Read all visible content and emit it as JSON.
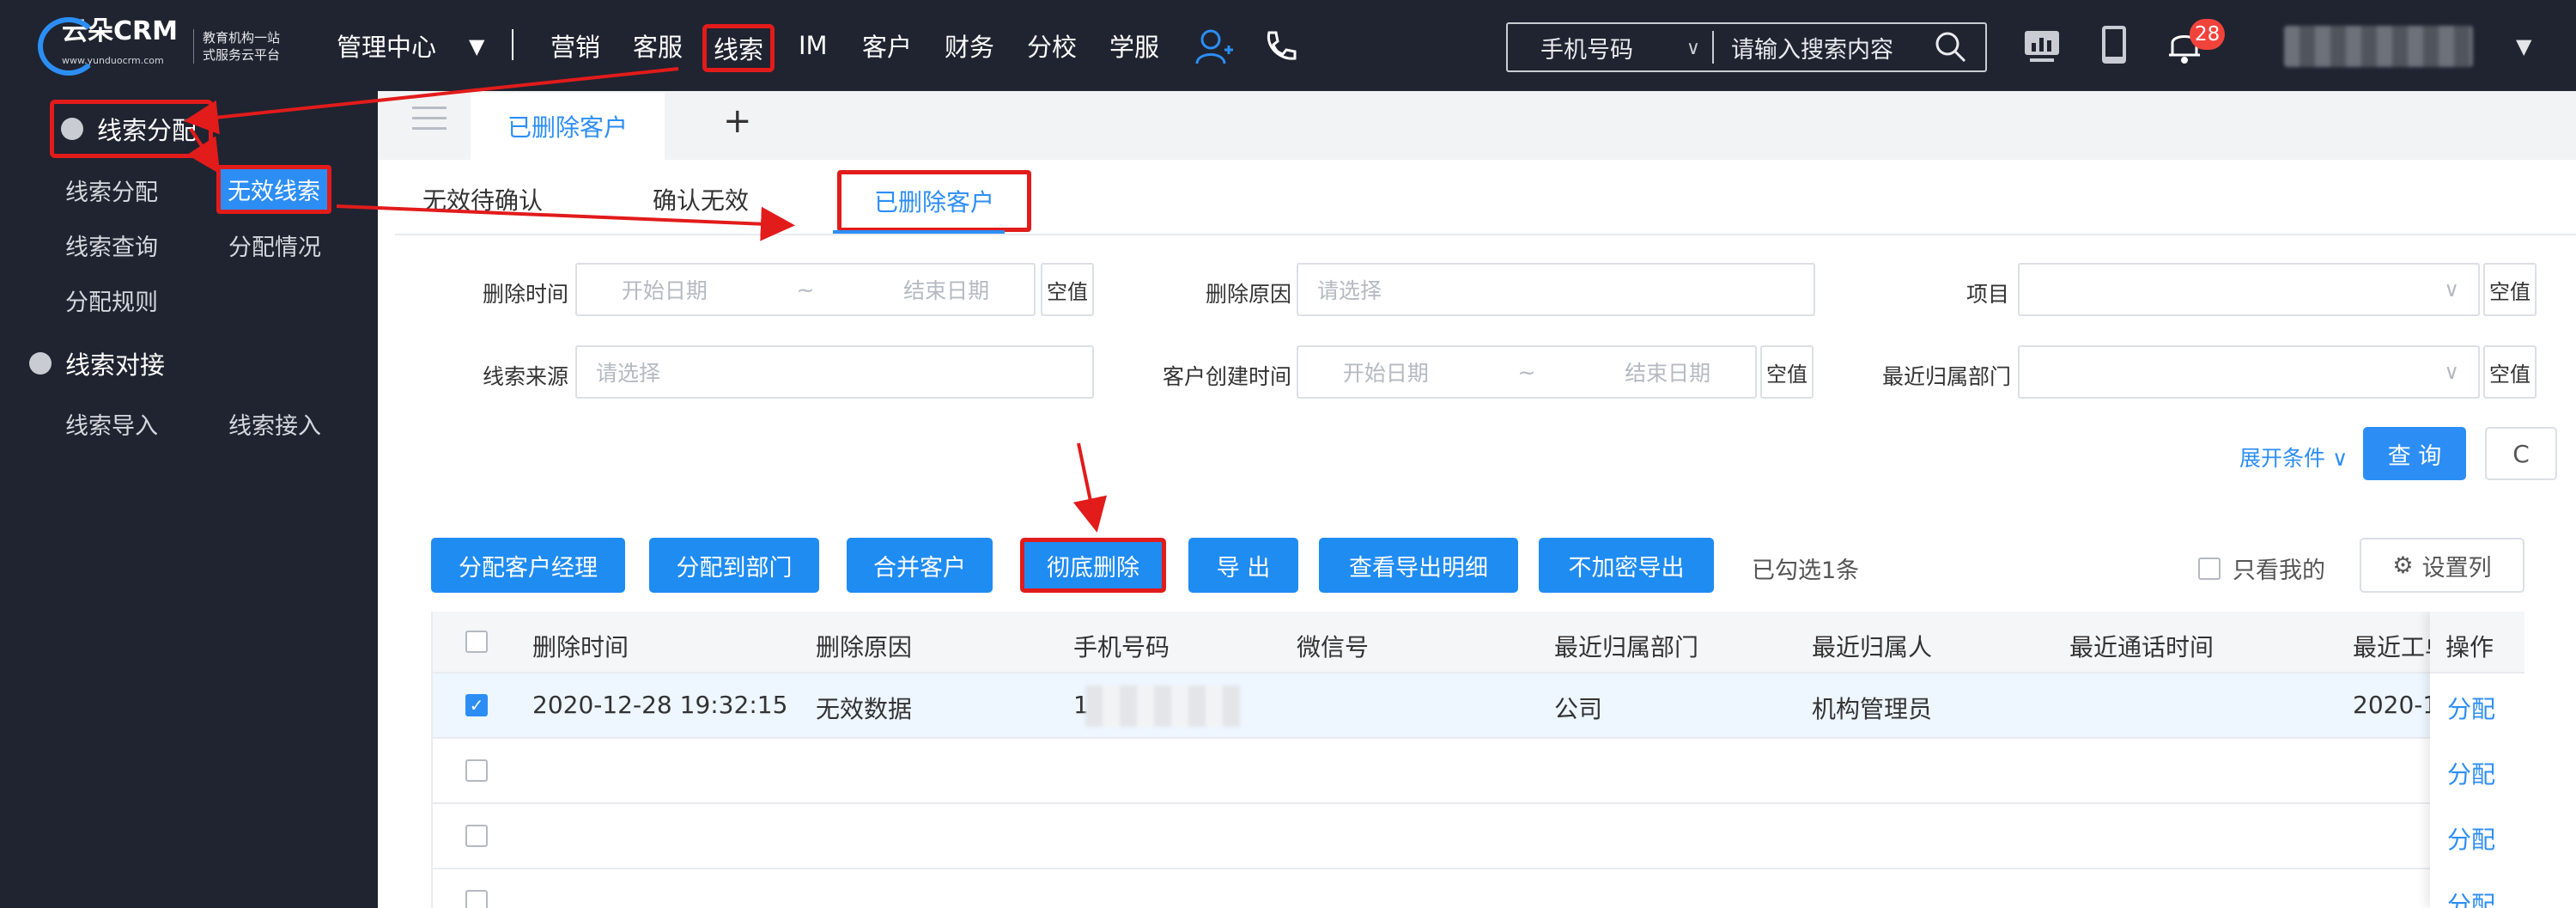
{
  "header": {
    "logo_text": "云朵CRM",
    "logo_url": "www.yunduocrm.com",
    "logo_slogan": "教育机构一站式服务云平台",
    "admin_center": "管理中心",
    "nav_items": [
      "营销",
      "客服",
      "线索",
      "IM",
      "客户",
      "财务",
      "分校",
      "学服"
    ],
    "search_type": "手机号码",
    "search_placeholder": "请输入搜索内容",
    "notification_count": "28"
  },
  "sidebar": {
    "group1": "线索分配",
    "group1_items": [
      "线索分配",
      "无效线索",
      "线索查询",
      "分配情况",
      "分配规则"
    ],
    "group2": "线索对接",
    "group2_items": [
      "线索导入",
      "线索接入"
    ]
  },
  "tabs": {
    "active": "已删除客户",
    "add": "+"
  },
  "subtabs": [
    "无效待确认",
    "确认无效",
    "已删除客户"
  ],
  "filters": {
    "delete_time": "删除时间",
    "start_date": "开始日期",
    "end_date": "结束日期",
    "range_sep": "~",
    "null_value": "空值",
    "delete_reason": "删除原因",
    "please_select": "请选择",
    "project": "项目",
    "lead_source": "线索来源",
    "create_time": "客户创建时间",
    "recent_dept": "最近归属部门",
    "expand": "展开条件",
    "query": "查 询",
    "reset": "C"
  },
  "actions": {
    "buttons": [
      "分配客户经理",
      "分配到部门",
      "合并客户",
      "彻底删除",
      "导 出",
      "查看导出明细",
      "不加密导出"
    ],
    "selected_count": "已勾选1条",
    "only_mine": "只看我的",
    "set_columns": "设置列"
  },
  "table": {
    "headers": [
      "删除时间",
      "删除原因",
      "手机号码",
      "微信号",
      "最近归属部门",
      "最近归属人",
      "最近通话时间",
      "最近工单"
    ],
    "op_header": "操作",
    "row1": {
      "delete_time": "2020-12-28 19:32:15",
      "reason": "无效数据",
      "phone_prefix": "1",
      "dept": "公司",
      "owner": "机构管理员",
      "last_ticket": "2020-1"
    },
    "op_link": "分配"
  },
  "colors": {
    "accent": "#2c8ef5",
    "annotation": "#e21b1b",
    "topbar": "#1f2430"
  }
}
